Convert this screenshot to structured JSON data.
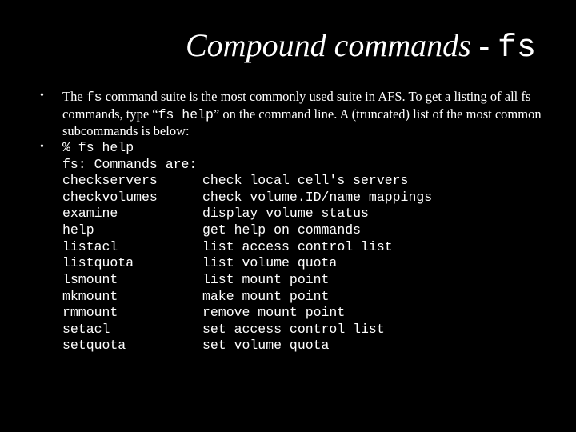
{
  "title": {
    "prefix": "Compound commands - ",
    "mono": "fs"
  },
  "intro": {
    "part1": "The ",
    "mono1": "fs",
    "part2": " command suite is the most commonly used suite in AFS.  To get a listing of all fs commands, type “",
    "mono2": "fs help",
    "part3": "” on the command line.  A (truncated) list of the most common subcommands is below:"
  },
  "code": {
    "line1": "% fs help",
    "line2": "fs: Commands are:"
  },
  "commands": [
    {
      "cmd": "checkservers",
      "desc": "check local cell's servers"
    },
    {
      "cmd": "checkvolumes",
      "desc": "check volume.ID/name mappings"
    },
    {
      "cmd": "examine",
      "desc": "display volume status"
    },
    {
      "cmd": "help",
      "desc": "get help on commands"
    },
    {
      "cmd": "listacl",
      "desc": "list access control list"
    },
    {
      "cmd": "listquota",
      "desc": "list volume quota"
    },
    {
      "cmd": "lsmount",
      "desc": "list mount point"
    },
    {
      "cmd": "mkmount",
      "desc": "make mount point"
    },
    {
      "cmd": "rmmount",
      "desc": "remove mount point"
    },
    {
      "cmd": "setacl",
      "desc": "set access control list"
    },
    {
      "cmd": "setquota",
      "desc": "set volume quota"
    }
  ]
}
